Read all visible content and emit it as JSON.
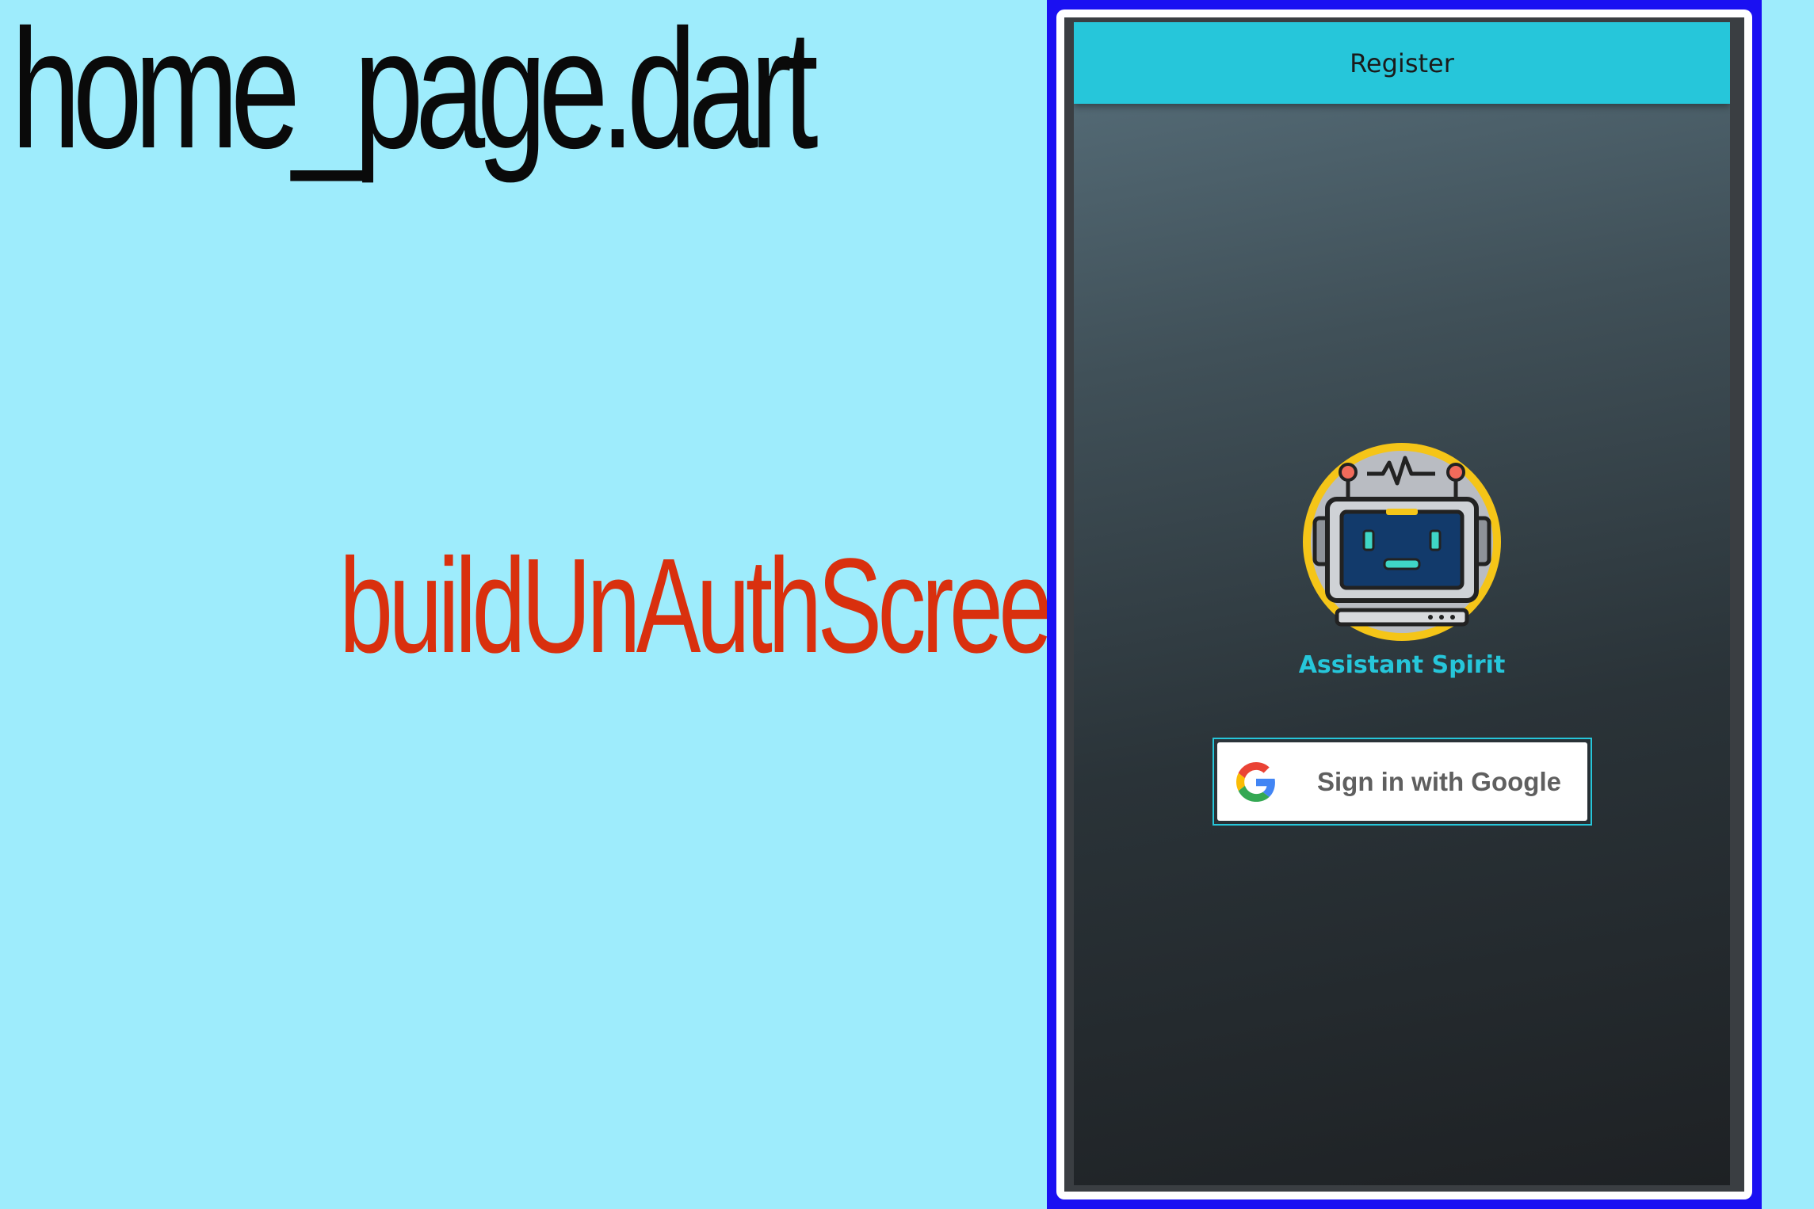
{
  "slide": {
    "file_title": "home_page.dart",
    "method_name": "buildUnAuthScreen( )"
  },
  "app": {
    "app_bar_title": "Register",
    "avatar_icon": "robot-computer-icon",
    "brand_name": "Assistant Spirit",
    "google_button_label": "Sign in with Google",
    "google_icon": "google-g-icon"
  },
  "colors": {
    "background": "#9eecfc",
    "app_bar": "#26c6da",
    "accent": "#26c6da",
    "method_text": "#d9300e",
    "frame_blue": "#1a10f2",
    "avatar_ring": "#f5c518"
  }
}
